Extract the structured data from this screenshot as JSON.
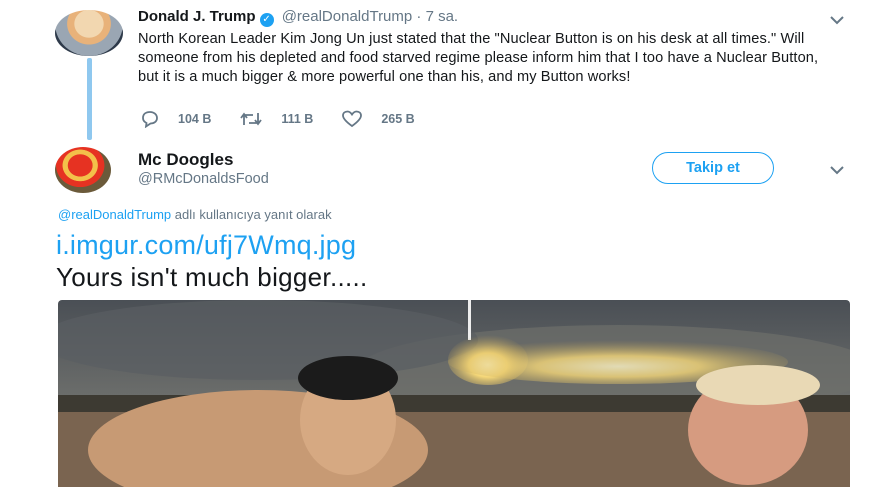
{
  "tweet1": {
    "name": "Donald J. Trump",
    "handle": "@realDonaldTrump",
    "time": "· 7 sa.",
    "text": "North Korean Leader Kim Jong Un just stated that the \"Nuclear Button is on his desk at all times.\" Will someone from his depleted and food starved regime please inform him that I too have a Nuclear Button, but it is a much bigger & more powerful one than his, and my Button works!",
    "replies": "104 B",
    "retweets": "111 B",
    "likes": "265 B"
  },
  "tweet2": {
    "name": "Mc Doogles",
    "handle": "@RMcDonaldsFood",
    "follow_label": "Takip et",
    "reply_link": "@realDonaldTrump",
    "reply_suffix": "adlı kullanıcıya yanıt olarak",
    "link": "i.imgur.com/ufj7Wmq.jpg",
    "text": "Yours isn't much bigger....."
  },
  "colors": {
    "accent": "#1da1f2",
    "muted": "#657786",
    "thread": "#8fc8ef"
  },
  "icons": [
    "verified-icon",
    "reply-icon",
    "retweet-icon",
    "like-icon",
    "chevron-down-icon"
  ]
}
